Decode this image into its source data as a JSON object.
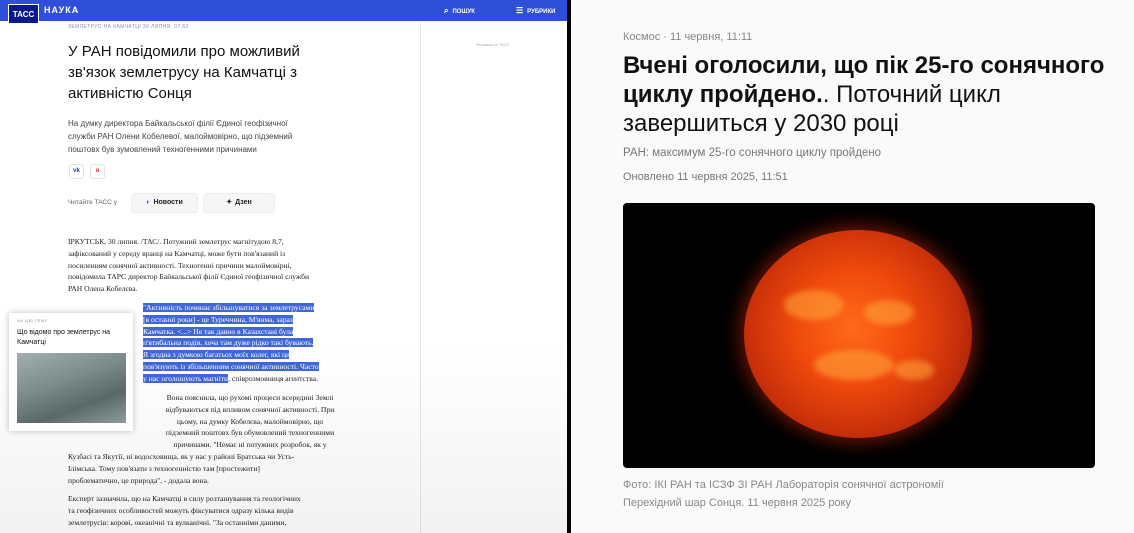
{
  "left": {
    "logo": "ТАСС",
    "section": "НАУКА",
    "search_label": "ПОШУК",
    "rubrics_label": "РУБРИКИ",
    "breadcrumb": "ЗЕМЛЕТРУС НА КАМЧАТЦІ   30 ЛИПНЯ, 07:52",
    "ad_label": "Реклама на ТАСС",
    "title_lines": [
      "У РАН повідомили про можливий",
      "зв'язок землетрусу на Камчатці з",
      "активністю Сонця"
    ],
    "lead_lines": [
      "На думку директора Байкальської філії Єдиної геофізичної",
      "служби РАН Олени Кобелевої, малоймовірно, що підземний",
      "поштовх був зумовлений техногенними причинами"
    ],
    "social": [
      "vk",
      "я"
    ],
    "read_label": "Читайте ТАСС у",
    "news_pill": "Новости",
    "dzen_pill": "Дзен",
    "p1": [
      "ІРКУТСЬК, 30 липня. /ТАС/. Потужний землетрус магнітудою 8,7,",
      "зафіксований у середу вранці на Камчатці, може бути пов'язаний із",
      "посиленням сонячної активності. Техногенні причини малоймовірні,",
      "повідомила ТАРС директор Байкальської філії Єдиної геофізичної служби",
      "РАН Олена Кобелєва."
    ],
    "quote_hl": [
      "\"Активність починає збільшуватися за землетрусами",
      "[в останні роки] - це Туреччина, М'янма, зараз",
      "Камчатка. <...> Не так давно в Казахстані була",
      "п'ятибальна подія, хоча там дуже рідко такі бувають.",
      "Я згодна з думкою багатьох моїх колег, які це",
      "пов'язують із збільшенням сонячної активності. Часто",
      "у нас оголошують магніти"
    ],
    "quote_tail": ", співрозмовниця агентства.",
    "p3": [
      "Вона пояснила, що рухомі процеси всередині Землі",
      "відбуваються під впливом сонячної активності. При",
      "цьому, на думку Кобелєва, малоймовірно, що",
      "підземний поштовх був обумовлений техногенними",
      "причинами. \"Немає ні потужних розробок, як у",
      "Кузбасі та Якутії, ні водосховища, як у нас у районі Братська чи Усть-",
      "Ілімська. Тому пов'язати з техногенністю там [простежити]",
      "проблематично, це природа\", - додала вона."
    ],
    "p4": [
      "Експерт зазначила, що на Камчатці в силу розташування та геологічних",
      "та геофізичних особливостей можуть фіксуватися одразу кілька видів",
      "землетрусів: корові, океанічні та вулканічні. \"За останніми даними,"
    ],
    "card_kicker": "НА ЦЮ ТЕМУ",
    "card_title": "Що відомо про землетрус на Камчатці"
  },
  "right": {
    "meta": "Космос · 11 червня, 11:11",
    "title_bold": "Вчені оголосили, що пік 25-го сонячного циклу пройдено.",
    "title_rest": ". Поточний цикл завершиться у 2030 році",
    "subtitle": "РАН: максимум 25-го сонячного циклу пройдено",
    "updated": "Оновлено 11 червня 2025, 11:51",
    "caption1": "Фото: ІКІ РАН та ІСЗФ ЗІ РАН Лабораторія сонячної астрономії",
    "caption2": "Перехідний шар Сонця. 11 червня 2025 року"
  },
  "colors": {
    "tass_blue": "#2f4fd8",
    "highlight": "#3f67d8",
    "sun": "#f04a0c"
  }
}
